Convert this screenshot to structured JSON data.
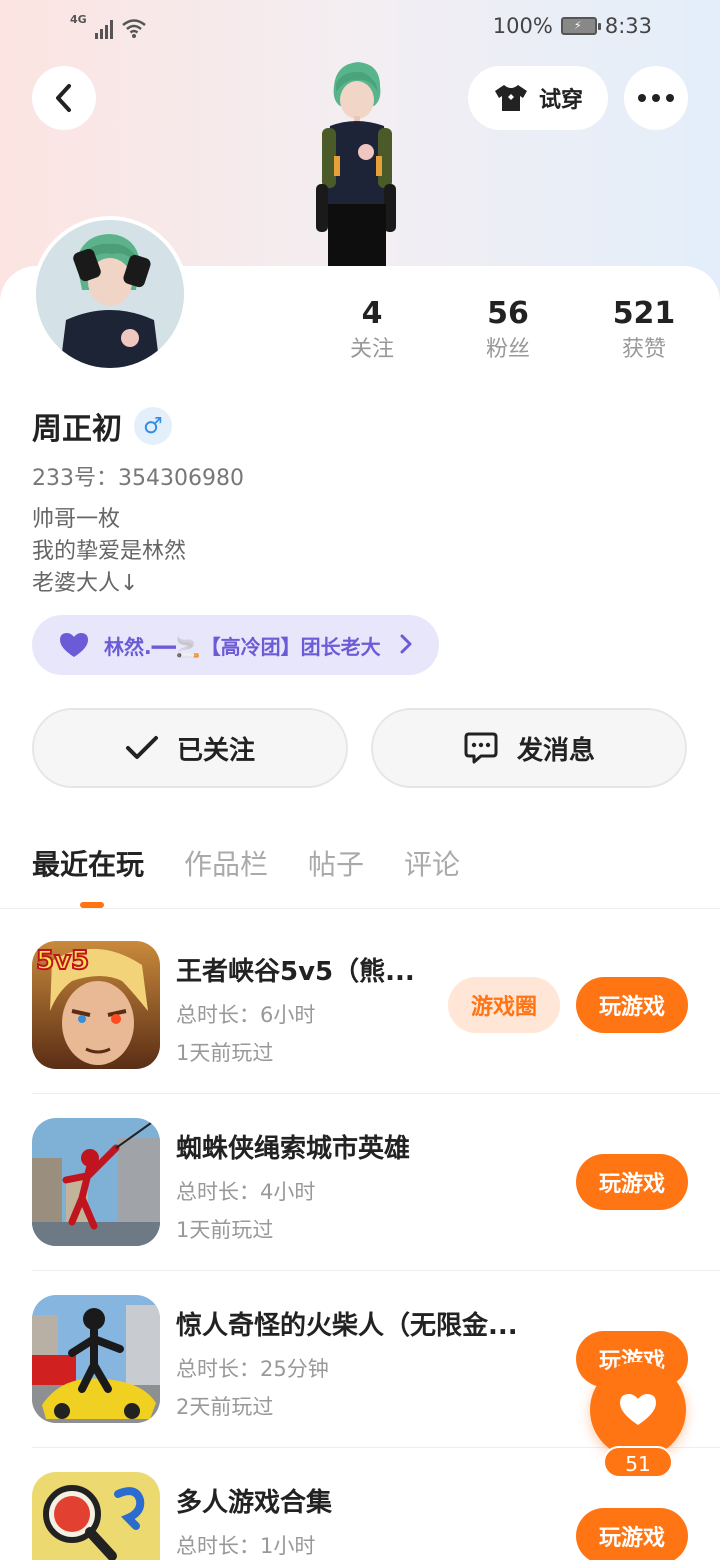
{
  "status_bar": {
    "network": "4G",
    "battery": "100%",
    "time": "8:33"
  },
  "header": {
    "try_on_label": "试穿"
  },
  "profile": {
    "stats": [
      {
        "value": "4",
        "label": "关注"
      },
      {
        "value": "56",
        "label": "粉丝"
      },
      {
        "value": "521",
        "label": "获赞"
      }
    ],
    "name": "周正初",
    "gender_symbol": "♂",
    "uid": "233号：354306980",
    "bio": [
      "帅哥一枚",
      "我的挚爱是林然",
      "老婆大人↓"
    ],
    "clan_tag": "林然.━━🚬【高冷团】团长老大"
  },
  "actions": {
    "follow_label": "已关注",
    "message_label": "发消息"
  },
  "tabs": [
    "最近在玩",
    "作品栏",
    "帖子",
    "评论"
  ],
  "games": [
    {
      "title": "王者峡谷5v5（熊...",
      "duration": "总时长：6小时",
      "last_played": "1天前玩过",
      "circle_label": "游戏圈",
      "play_label": "玩游戏",
      "icon_badge": "5v5"
    },
    {
      "title": "蜘蛛侠绳索城市英雄",
      "duration": "总时长：4小时",
      "last_played": "1天前玩过",
      "play_label": "玩游戏"
    },
    {
      "title": "惊人奇怪的火柴人（无限金...",
      "duration": "总时长：25分钟",
      "last_played": "2天前玩过",
      "play_label": "玩游戏"
    },
    {
      "title": "多人游戏合集",
      "duration": "总时长：1小时",
      "last_played": "",
      "play_label": "玩游戏"
    }
  ],
  "like_fab": {
    "count": "51"
  },
  "colors": {
    "accent": "#ff7413",
    "clan_bg": "#e8e6fb",
    "clan_text": "#6c5bd6"
  }
}
